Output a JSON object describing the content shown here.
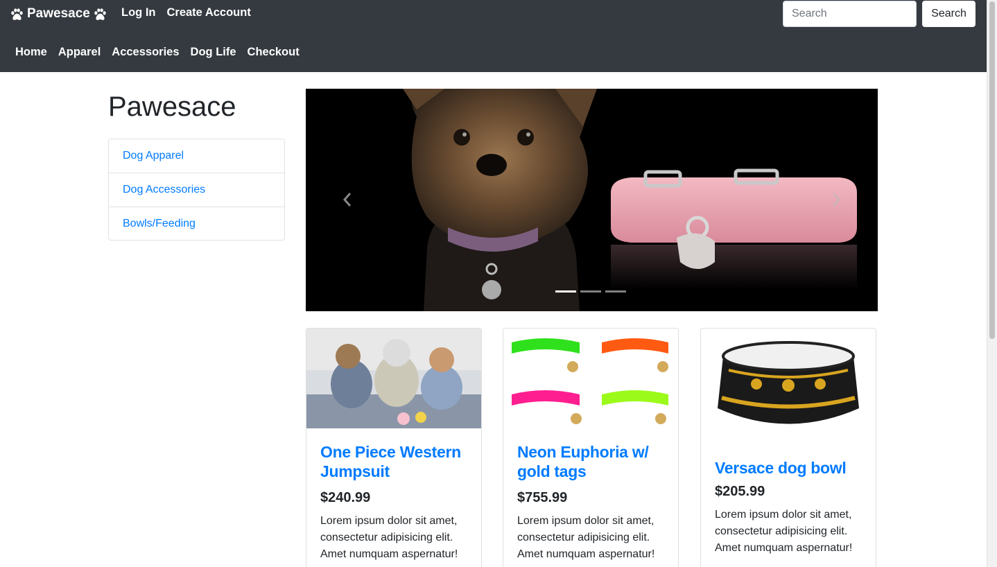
{
  "navbar": {
    "brand": "Pawesace",
    "brand_icons": [
      "paw-icon",
      "paw-icon"
    ],
    "top_links": [
      "Log In",
      "Create Account"
    ],
    "main_links": [
      "Home",
      "Apparel",
      "Accessories",
      "Dog Life",
      "Checkout"
    ],
    "search_placeholder": "Search",
    "search_button": "Search"
  },
  "sidebar": {
    "title": "Pawesace",
    "categories": [
      "Dog Apparel",
      "Dog Accessories",
      "Bowls/Feeding"
    ]
  },
  "carousel": {
    "slide_count": 3,
    "active_slide": 1,
    "image_desc": "yorkie-with-pink-glitter-collar",
    "prev_icon": "chevron-left-icon",
    "next_icon": "chevron-right-icon"
  },
  "products": [
    {
      "title": "One Piece Western Jumpsuit",
      "price": "$240.99",
      "description": "Lorem ipsum dolor sit amet, consectetur adipisicing elit. Amet numquam aspernatur!"
    },
    {
      "title": "Neon Euphoria w/ gold tags",
      "price": "$755.99",
      "description": "Lorem ipsum dolor sit amet, consectetur adipisicing elit. Amet numquam aspernatur!"
    },
    {
      "title": "Versace dog bowl",
      "price": "$205.99",
      "description": "Lorem ipsum dolor sit amet, consectetur adipisicing elit. Amet numquam aspernatur!"
    }
  ],
  "colors": {
    "navbar_bg": "#343a40",
    "link": "#007bff",
    "text": "#212529"
  }
}
